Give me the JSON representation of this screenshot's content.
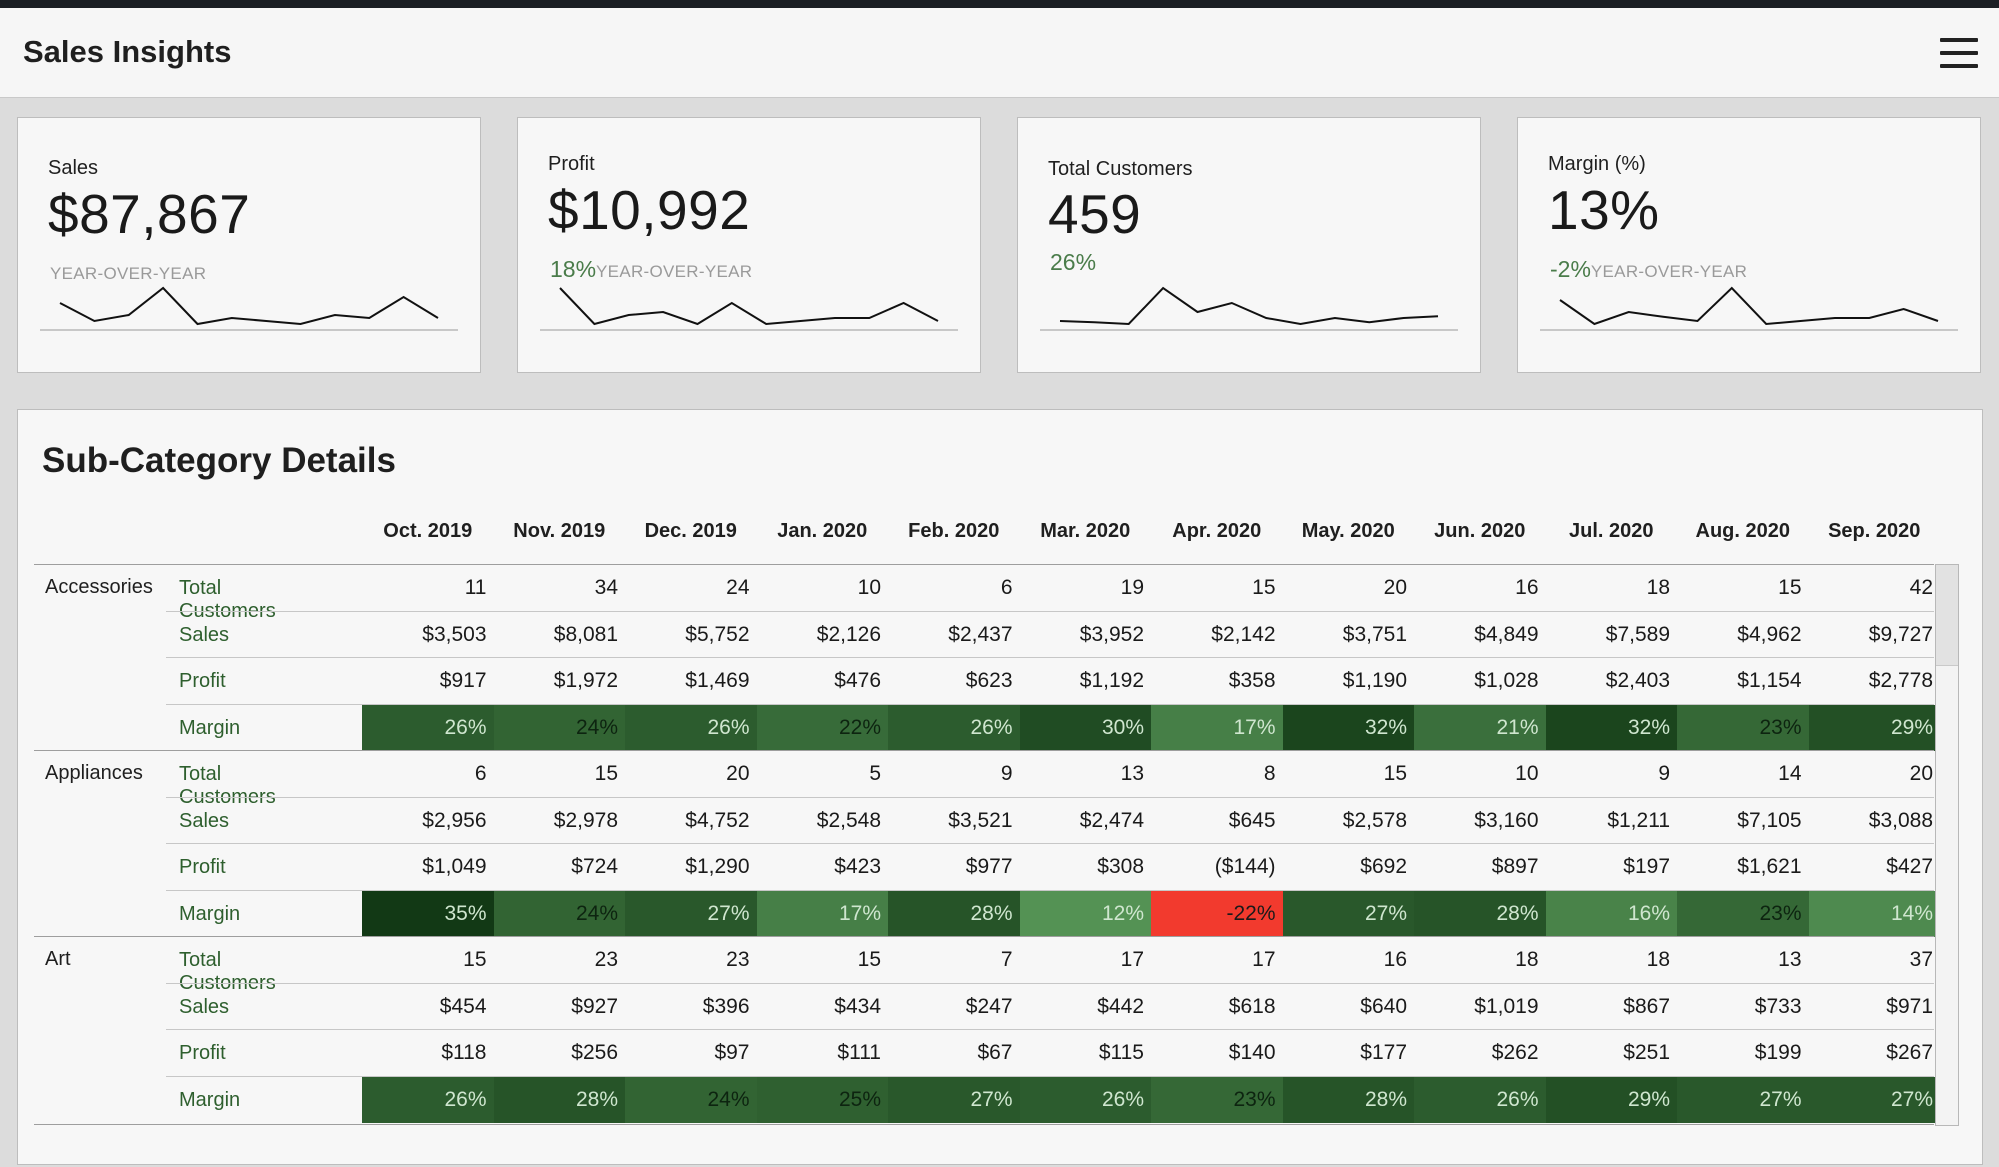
{
  "app": {
    "title": "Sales Insights",
    "menu_icon": "hamburger-menu-icon"
  },
  "kpis": [
    {
      "label": "Sales",
      "value": "$87,867",
      "change": "",
      "change_label": "YEAR-OVER-YEAR",
      "sparkline": [
        6.5,
        3.5,
        4.5,
        9,
        3,
        4,
        3.5,
        3,
        4.5,
        4,
        7.5,
        4
      ]
    },
    {
      "label": "Profit",
      "value": "$10,992",
      "change": "18%",
      "change_label": "YEAR-OVER-YEAR",
      "sparkline": [
        9,
        3,
        4.5,
        5,
        3,
        6.5,
        3,
        3.5,
        4,
        4,
        6.5,
        3.5
      ]
    },
    {
      "label": "Total Customers",
      "value": "459",
      "change": "26%",
      "change_label": "",
      "sparkline": [
        3.5,
        3.3,
        3,
        9,
        5,
        6.5,
        4,
        3,
        4,
        3.3,
        4,
        4.3
      ]
    },
    {
      "label": "Margin (%)",
      "value": "13%",
      "change": "-2%",
      "change_label": "YEAR-OVER-YEAR",
      "sparkline": [
        7,
        3,
        5,
        4.2,
        3.5,
        9,
        3,
        3.5,
        4,
        4,
        5.5,
        3.5
      ]
    }
  ],
  "details": {
    "title": "Sub-Category Details",
    "months": [
      "Oct. 2019",
      "Nov. 2019",
      "Dec. 2019",
      "Jan. 2020",
      "Feb. 2020",
      "Mar. 2020",
      "Apr. 2020",
      "May. 2020",
      "Jun. 2020",
      "Jul. 2020",
      "Aug. 2020",
      "Sep. 2020"
    ],
    "categories": [
      {
        "name": "Accessories",
        "rows": [
          {
            "metric": "Total Customers",
            "values": [
              "11",
              "34",
              "24",
              "10",
              "6",
              "19",
              "15",
              "20",
              "16",
              "18",
              "15",
              "42"
            ]
          },
          {
            "metric": "Sales",
            "values": [
              "$3,503",
              "$8,081",
              "$5,752",
              "$2,126",
              "$2,437",
              "$3,952",
              "$2,142",
              "$3,751",
              "$4,849",
              "$7,589",
              "$4,962",
              "$9,727"
            ]
          },
          {
            "metric": "Profit",
            "values": [
              "$917",
              "$1,972",
              "$1,469",
              "$476",
              "$623",
              "$1,192",
              "$358",
              "$1,190",
              "$1,028",
              "$2,403",
              "$1,154",
              "$2,778"
            ]
          },
          {
            "metric": "Margin",
            "values": [
              "26%",
              "24%",
              "26%",
              "22%",
              "26%",
              "30%",
              "17%",
              "32%",
              "21%",
              "32%",
              "23%",
              "29%"
            ],
            "margin_numbers": [
              26,
              24,
              26,
              22,
              26,
              30,
              17,
              32,
              21,
              32,
              23,
              29
            ]
          }
        ]
      },
      {
        "name": "Appliances",
        "rows": [
          {
            "metric": "Total Customers",
            "values": [
              "6",
              "15",
              "20",
              "5",
              "9",
              "13",
              "8",
              "15",
              "10",
              "9",
              "14",
              "20"
            ]
          },
          {
            "metric": "Sales",
            "values": [
              "$2,956",
              "$2,978",
              "$4,752",
              "$2,548",
              "$3,521",
              "$2,474",
              "$645",
              "$2,578",
              "$3,160",
              "$1,211",
              "$7,105",
              "$3,088"
            ]
          },
          {
            "metric": "Profit",
            "values": [
              "$1,049",
              "$724",
              "$1,290",
              "$423",
              "$977",
              "$308",
              "($144)",
              "$692",
              "$897",
              "$197",
              "$1,621",
              "$427"
            ]
          },
          {
            "metric": "Margin",
            "values": [
              "35%",
              "24%",
              "27%",
              "17%",
              "28%",
              "12%",
              "-22%",
              "27%",
              "28%",
              "16%",
              "23%",
              "14%"
            ],
            "margin_numbers": [
              35,
              24,
              27,
              17,
              28,
              12,
              -22,
              27,
              28,
              16,
              23,
              14
            ]
          }
        ]
      },
      {
        "name": "Art",
        "rows": [
          {
            "metric": "Total Customers",
            "values": [
              "15",
              "23",
              "23",
              "15",
              "7",
              "17",
              "17",
              "16",
              "18",
              "18",
              "13",
              "37"
            ]
          },
          {
            "metric": "Sales",
            "values": [
              "$454",
              "$927",
              "$396",
              "$434",
              "$247",
              "$442",
              "$618",
              "$640",
              "$1,019",
              "$867",
              "$733",
              "$971"
            ]
          },
          {
            "metric": "Profit",
            "values": [
              "$118",
              "$256",
              "$97",
              "$111",
              "$67",
              "$115",
              "$140",
              "$177",
              "$262",
              "$251",
              "$199",
              "$267"
            ]
          },
          {
            "metric": "Margin",
            "values": [
              "26%",
              "28%",
              "24%",
              "25%",
              "27%",
              "26%",
              "23%",
              "28%",
              "26%",
              "29%",
              "27%",
              "27%"
            ],
            "margin_numbers": [
              26,
              28,
              24,
              25,
              27,
              26,
              23,
              28,
              26,
              29,
              27,
              27
            ]
          }
        ]
      }
    ]
  },
  "colors": {
    "negative": "#f23a2e",
    "positive_light": "#5a9a5a",
    "positive_dark": "#1f5a25",
    "accent_green": "#4a7c4a"
  }
}
